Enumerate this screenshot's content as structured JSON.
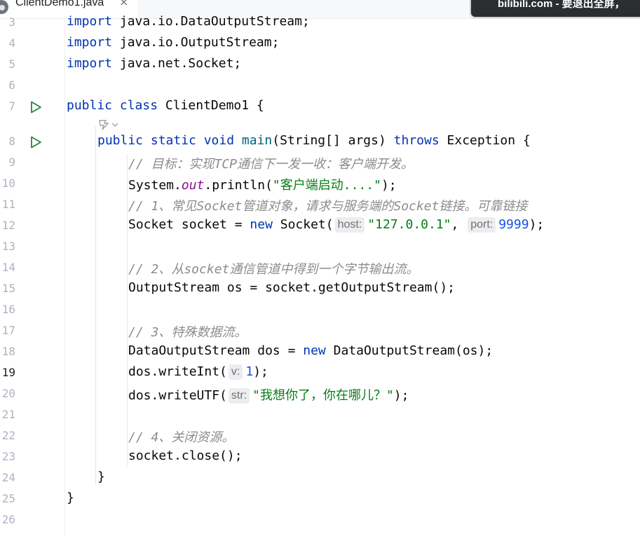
{
  "tab": {
    "title": "ClientDemo1.java",
    "close_glyph": "×"
  },
  "toast": {
    "text": "bilibili.com - 要退出全屏，"
  },
  "editor": {
    "active_line": "19",
    "lines": [
      {
        "n": "3",
        "parts": [
          [
            "kw",
            "import"
          ],
          [
            "",
            ""
          ],
          [
            "",
            "java.io.DataOutputStream;"
          ]
        ],
        "text": "import java.io.DataOutputStream;"
      },
      {
        "n": "4"
      },
      {
        "n": "5"
      },
      {
        "n": "6"
      },
      {
        "n": "7"
      },
      {
        "n": "8"
      },
      {
        "n": "9"
      },
      {
        "n": "10"
      },
      {
        "n": "11"
      },
      {
        "n": "12"
      },
      {
        "n": "13"
      },
      {
        "n": "14"
      },
      {
        "n": "15"
      },
      {
        "n": "16"
      },
      {
        "n": "17"
      },
      {
        "n": "18"
      },
      {
        "n": "19"
      },
      {
        "n": "20"
      },
      {
        "n": "21"
      },
      {
        "n": "22"
      },
      {
        "n": "23"
      },
      {
        "n": "24"
      },
      {
        "n": "25"
      },
      {
        "n": "26"
      }
    ],
    "code": {
      "l3_kw": "import",
      "l3_rest": " java.io.DataOutputStream;",
      "l4_kw": "import",
      "l4_rest": " java.io.OutputStream;",
      "l5_kw": "import",
      "l5_rest": " java.net.Socket;",
      "l7_kw": "public class",
      "l7_rest": " ClientDemo1 {",
      "l8_kw": "public static void",
      "l8_fn": " main",
      "l8_rest": "(String[] args) ",
      "l8_kw2": "throws",
      "l8_rest2": " Exception {",
      "l9_cmt": "// 目标：实现TCP通信下一发一收：客户端开发。",
      "l10_a": "System.",
      "l10_field": "out",
      "l10_b": ".println(",
      "l10_str": "\"客户端启动....\"",
      "l10_c": ");",
      "l11_cmt": "// 1、常见Socket管道对象，请求与服务端的Socket链接。可靠链接",
      "l12_a": "Socket socket = ",
      "l12_kw": "new",
      "l12_b": " Socket(",
      "l12_hint1": "host:",
      "l12_str": "\"127.0.0.1\"",
      "l12_c": ", ",
      "l12_hint2": "port:",
      "l12_num": "9999",
      "l12_d": ");",
      "l14_cmt": "// 2、从socket通信管道中得到一个字节输出流。",
      "l15": "OutputStream os = socket.getOutputStream();",
      "l17_cmt": "// 3、特殊数据流。",
      "l18_a": "DataOutputStream dos = ",
      "l18_kw": "new",
      "l18_b": " DataOutputStream(os);",
      "l19_a": "dos.writeInt(",
      "l19_hint": "v:",
      "l19_num": "1",
      "l19_b": ");",
      "l20_a": "dos.writeUTF(",
      "l20_hint": "str:",
      "l20_str": "\"我想你了，你在哪儿？\"",
      "l20_b": ");",
      "l22_cmt": "// 4、关闭资源。",
      "l23": "socket.close();",
      "l24": "}",
      "l25": "}"
    }
  },
  "icons": {
    "run_class": "run-icon",
    "run_main": "run-icon",
    "ai_hint": "ai-assistant-icon"
  },
  "colors": {
    "keyword": "#0033b3",
    "string": "#067d17",
    "number": "#1750eb",
    "comment": "#8c8c8c",
    "field": "#871094",
    "method": "#00627a",
    "run_icon": "#208a3c",
    "tab_underline": "#3574f0"
  }
}
